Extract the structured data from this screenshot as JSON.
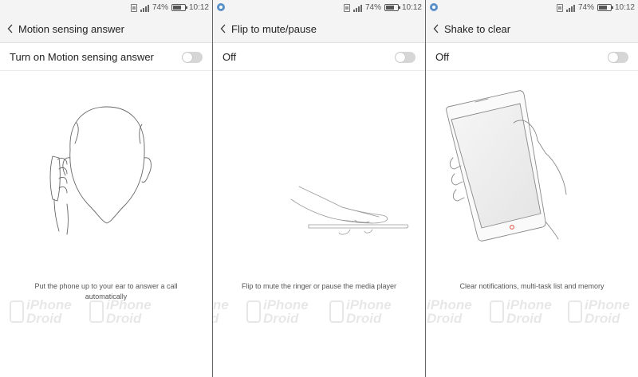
{
  "status_bar": {
    "battery": "74%",
    "time": "10:12"
  },
  "screens": [
    {
      "title": "Motion sensing answer",
      "toggle_label": "Turn on Motion sensing answer",
      "toggle_on": false,
      "caption": "Put the phone up to your ear to answer a call automatically",
      "illustration": "head-with-phone-at-ear"
    },
    {
      "title": "Flip to mute/pause",
      "toggle_label": "Off",
      "toggle_on": false,
      "caption": "Flip to mute the ringer or pause the media player",
      "illustration": "hand-flipping-phone"
    },
    {
      "title": "Shake to clear",
      "toggle_label": "Off",
      "toggle_on": false,
      "caption": "Clear notifications, multi-task list and memory",
      "illustration": "hand-holding-phone"
    }
  ],
  "watermark": {
    "line1": "iPhone",
    "line2": "Droid"
  },
  "colors": {
    "statusbar_bg": "#f4f4f4",
    "toggle_off": "#d6d6d6",
    "notification_dot": "#5a8fc8",
    "phone_button": "#e24a3b"
  }
}
